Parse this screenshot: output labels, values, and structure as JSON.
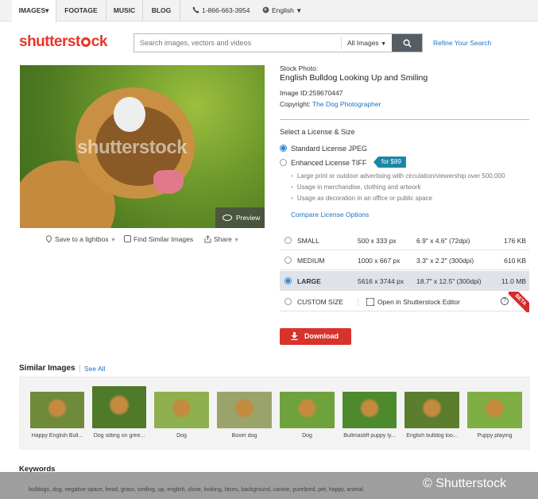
{
  "nav": {
    "items": [
      "IMAGES",
      "FOOTAGE",
      "MUSIC",
      "BLOG"
    ],
    "images_caret": "▾",
    "phone": "1-866-663-3954",
    "language": "English"
  },
  "header": {
    "logo_pre": "shutterst",
    "logo_post": "ck",
    "search_placeholder": "Search images, vectors and videos",
    "search_scope": "All Images",
    "refine": "Refine Your Search"
  },
  "photo": {
    "watermark": "shutterstock",
    "preview_label": "Preview",
    "actions": {
      "lightbox": "Save to a lightbox",
      "similar": "Find Similar Images",
      "share": "Share"
    }
  },
  "details": {
    "type_label": "Stock Photo:",
    "title": "English Bulldog Looking Up and Smiling",
    "image_id_label": "Image ID:",
    "image_id": "259670447",
    "copyright_label": "Copyright:",
    "copyright_owner": "The Dog Photographer"
  },
  "license": {
    "section_title": "Select a License & Size",
    "options": [
      {
        "label": "Standard License JPEG",
        "selected": true
      },
      {
        "label": "Enhanced License TIFF",
        "selected": false
      }
    ],
    "enhanced_price": "for $89",
    "bullets": [
      "Large print or outdoor advertising with circulation/viewership over 500,000",
      "Usage in merchandise, clothing and artwork",
      "Usage as decoration in an office or public space"
    ],
    "compare_link": "Compare License Options"
  },
  "sizes": [
    {
      "name": "SMALL",
      "px": "500 x 333 px",
      "dim": "6.9\" x 4.6\" (72dpi)",
      "file": "176 KB",
      "selected": false
    },
    {
      "name": "MEDIUM",
      "px": "1000 x 667 px",
      "dim": "3.3\" x 2.2\" (300dpi)",
      "file": "610 KB",
      "selected": false
    },
    {
      "name": "LARGE",
      "px": "5616 x 3744 px",
      "dim": "18.7\" x 12.5\" (300dpi)",
      "file": "11.0 MB",
      "selected": true
    }
  ],
  "custom_size": {
    "name": "CUSTOM SIZE",
    "editor": "Open in Shutterstock Editor",
    "help": "?",
    "beta": "BETA"
  },
  "download_label": "Download",
  "similar": {
    "title": "Similar Images",
    "see_all": "See All",
    "items": [
      {
        "caption": "Happy English Bull...",
        "color": "#6f8a3a"
      },
      {
        "caption": "Dog sitting on gree...",
        "color": "#4f7a2a"
      },
      {
        "caption": "Dog",
        "color": "#8fb04e"
      },
      {
        "caption": "Boxer dog",
        "color": "#9aa46a"
      },
      {
        "caption": "Dog",
        "color": "#6ea23c"
      },
      {
        "caption": "Bullmastiff puppy ly...",
        "color": "#4d8a2e"
      },
      {
        "caption": "English bulldog loo...",
        "color": "#5a7e2e"
      },
      {
        "caption": "Puppy playing",
        "color": "#7fae44"
      }
    ]
  },
  "keywords": {
    "title": "Keywords",
    "text": "bulldogs, dog, negative space, head, grass, smiling, up, english, close, looking, faces, background, canine, purebred, pet, happy, animal"
  },
  "credit": "© Shutterstock"
}
